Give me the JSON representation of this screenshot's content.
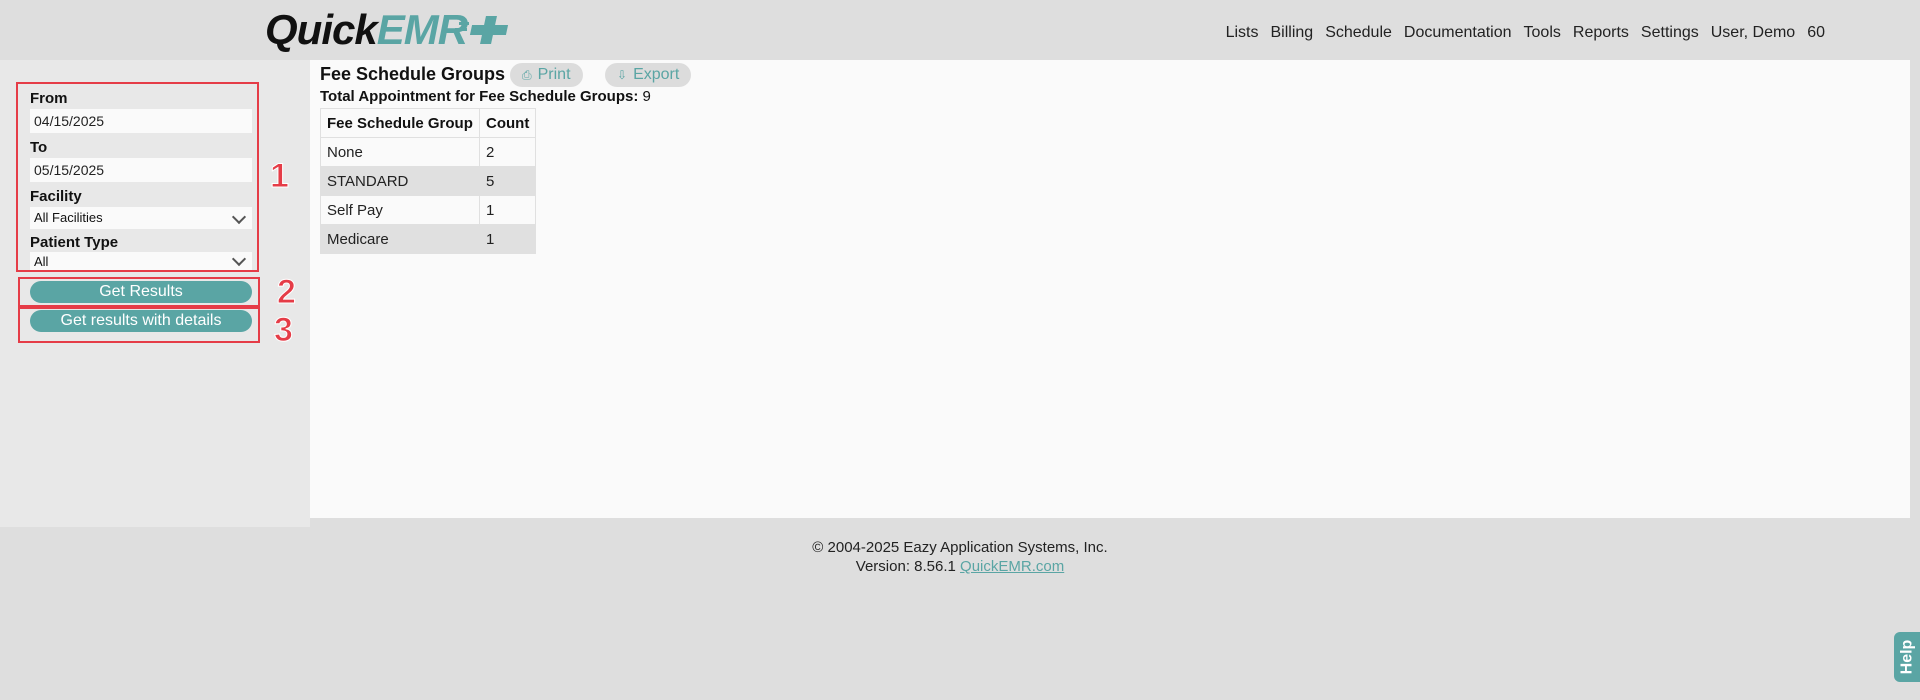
{
  "header": {
    "logo": {
      "part1": "Quick",
      "part2": "EMR"
    },
    "nav": [
      "Lists",
      "Billing",
      "Schedule",
      "Documentation",
      "Tools",
      "Reports",
      "Settings",
      "User, Demo",
      "60"
    ]
  },
  "filters": {
    "from_label": "From",
    "from_value": "04/15/2025",
    "to_label": "To",
    "to_value": "05/15/2025",
    "facility_label": "Facility",
    "facility_value": "All Facilities",
    "patient_type_label": "Patient Type",
    "patient_type_value": "All",
    "get_results": "Get Results",
    "get_results_details": "Get results with details"
  },
  "annotations": [
    "1",
    "2",
    "3"
  ],
  "main": {
    "title": "Fee Schedule Groups",
    "print_label": "Print",
    "export_label": "Export",
    "total_label": "Total Appointment for Fee Schedule Groups:",
    "total_value": "9",
    "table": {
      "headers": [
        "Fee Schedule Group",
        "Count"
      ],
      "rows": [
        [
          "None",
          "2"
        ],
        [
          "STANDARD",
          "5"
        ],
        [
          "Self Pay",
          "1"
        ],
        [
          "Medicare",
          "1"
        ]
      ]
    }
  },
  "footer": {
    "copyright": "© 2004-2025 Eazy Application Systems, Inc.",
    "version": "Version: 8.56.1",
    "link": "QuickEMR.com"
  },
  "help_label": "Help",
  "colors": {
    "accent": "#5aa5a4",
    "annotation": "#e53c47"
  }
}
